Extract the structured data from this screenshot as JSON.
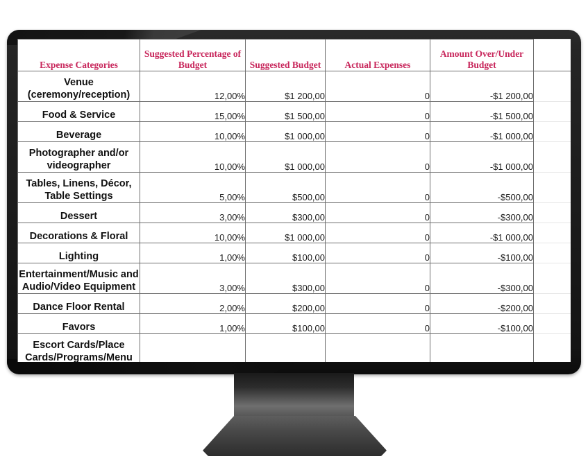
{
  "device": {
    "type": "desktop-monitor",
    "bezel_color": "#1c1c1c",
    "stand_color": "#4a4a4a"
  },
  "spreadsheet": {
    "accent_color": "#c8275c",
    "columns": [
      {
        "key": "category",
        "label": "Expense Categories"
      },
      {
        "key": "percentage",
        "label": "Suggested Percentage of Budget"
      },
      {
        "key": "suggested",
        "label": "Suggested Budget"
      },
      {
        "key": "actual",
        "label": "Actual Expenses"
      },
      {
        "key": "over_under",
        "label": "Amount Over/Under Budget"
      },
      {
        "key": "spare",
        "label": ""
      }
    ],
    "rows": [
      {
        "category_lines": [
          "Venue",
          "(ceremony/reception)"
        ],
        "percentage": "12,00%",
        "suggested": "$1 200,00",
        "actual": "0",
        "over_under": "-$1 200,00"
      },
      {
        "category_lines": [
          "Food & Service"
        ],
        "percentage": "15,00%",
        "suggested": "$1 500,00",
        "actual": "0",
        "over_under": "-$1 500,00"
      },
      {
        "category_lines": [
          "Beverage"
        ],
        "percentage": "10,00%",
        "suggested": "$1 000,00",
        "actual": "0",
        "over_under": "-$1 000,00"
      },
      {
        "category_lines": [
          "Photographer and/or",
          "videographer"
        ],
        "percentage": "10,00%",
        "suggested": "$1 000,00",
        "actual": "0",
        "over_under": "-$1 000,00"
      },
      {
        "category_lines": [
          "Tables, Linens, Décor,",
          "Table Settings"
        ],
        "percentage": "5,00%",
        "suggested": "$500,00",
        "actual": "0",
        "over_under": "-$500,00"
      },
      {
        "category_lines": [
          "Dessert"
        ],
        "percentage": "3,00%",
        "suggested": "$300,00",
        "actual": "0",
        "over_under": "-$300,00"
      },
      {
        "category_lines": [
          "Decorations & Floral"
        ],
        "percentage": "10,00%",
        "suggested": "$1 000,00",
        "actual": "0",
        "over_under": "-$1 000,00"
      },
      {
        "category_lines": [
          "Lighting"
        ],
        "percentage": "1,00%",
        "suggested": "$100,00",
        "actual": "0",
        "over_under": "-$100,00"
      },
      {
        "category_lines": [
          "Entertainment/Music and",
          "Audio/Video Equipment"
        ],
        "percentage": "3,00%",
        "suggested": "$300,00",
        "actual": "0",
        "over_under": "-$300,00"
      },
      {
        "category_lines": [
          "Dance Floor Rental"
        ],
        "percentage": "2,00%",
        "suggested": "$200,00",
        "actual": "0",
        "over_under": "-$200,00"
      },
      {
        "category_lines": [
          "Favors"
        ],
        "percentage": "1,00%",
        "suggested": "$100,00",
        "actual": "0",
        "over_under": "-$100,00"
      },
      {
        "category_lines": [
          "Escort Cards/Place",
          "Cards/Programs/Menu"
        ],
        "percentage": "",
        "suggested": "",
        "actual": "",
        "over_under": ""
      }
    ]
  }
}
